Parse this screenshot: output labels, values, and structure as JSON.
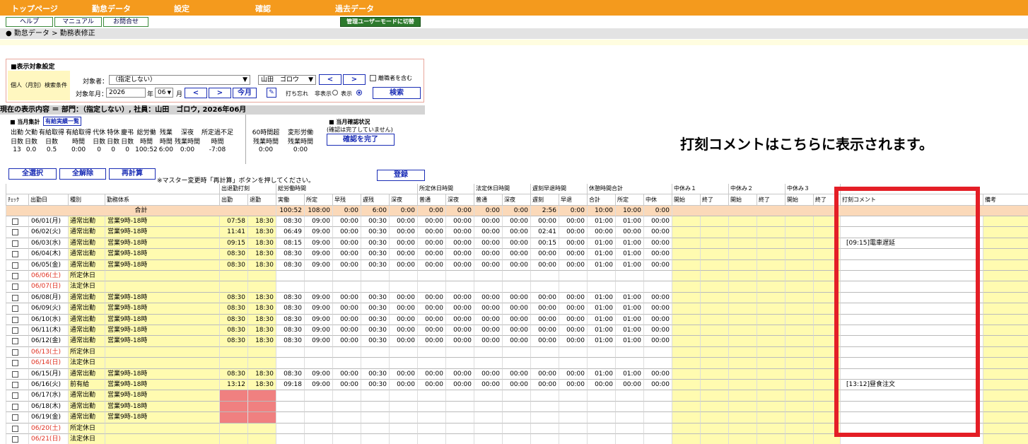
{
  "nav": {
    "items": [
      "トップページ",
      "勤怠データ",
      "設定",
      "確認",
      "過去データ"
    ]
  },
  "subnav": {
    "items": [
      "ヘルプ",
      "マニュアル",
      "お問合せ"
    ],
    "admin": "管理ユーザーモードに切替"
  },
  "breadcrumb": "● 勤怠データ > 勤務表修正",
  "filter": {
    "title": "■表示対象設定",
    "cond_label": "個人（月別）検索条件",
    "target_label": "対象者：",
    "target_value": "（指定しない）",
    "employee": "山田　ゴロウ",
    "prev": "<",
    "next": ">",
    "include_retired": "離職者を含む",
    "ym_label": "対象年月：",
    "year": "2026",
    "year_unit": "年",
    "month": "06",
    "month_unit": "月",
    "this_month": "今月",
    "missing_label": "打ち忘れ",
    "hide": "非表示",
    "show": "表示",
    "search": "検索"
  },
  "current": "現在の表示内容 ＝ 部門：（指定しない）, 社員：山田　ゴロウ, 2026年06月",
  "summary": {
    "title": "■ 当月集計",
    "link": "有給実績一覧",
    "h1": [
      "出勤",
      "欠勤",
      "有給取得",
      "有給取得",
      "代休",
      "特休",
      "慶弔",
      "総労働",
      "残業",
      "深夜",
      "所定過不足"
    ],
    "h2": [
      "日数",
      "日数",
      "日数",
      "時間",
      "日数",
      "日数",
      "日数",
      "時間",
      "時間",
      "残業時間",
      "時間"
    ],
    "vals": [
      "13",
      "0.0",
      "0.5",
      "0:00",
      "0",
      "0",
      "0",
      "100:52",
      "6:00",
      "0:00",
      "-7:08"
    ],
    "h60a": [
      "60時間超",
      "変形労働"
    ],
    "h60b": [
      "残業時間",
      "残業時間"
    ],
    "v60": [
      "0:00",
      "0:00"
    ]
  },
  "confirm": {
    "title": "■ 当月確認状況",
    "note": "(確認は完了していません)",
    "button": "確認を完了"
  },
  "message": "打刻コメントはこちらに表示されます。",
  "actions": {
    "select_all": "全選択",
    "clear_all": "全解除",
    "recalc": "再計算",
    "note": "※マスター変更時「再計算」ボタンを押してください。",
    "register": "登録"
  },
  "table": {
    "groups": [
      "出退勤打刻",
      "総労働時間",
      "所定休日時間",
      "法定休日時間",
      "遅刻早退時間",
      "休憩時間合計",
      "中休み１",
      "中休み２",
      "中休み３"
    ],
    "headers": [
      "ﾁｪｯｸ",
      "出勤日",
      "種別",
      "勤務体系",
      "出勤",
      "退勤",
      "実働",
      "所定",
      "早残",
      "遅残",
      "深夜",
      "普通",
      "深夜",
      "普通",
      "深夜",
      "遅刻",
      "早退",
      "合計",
      "所定",
      "中休",
      "開始",
      "終了",
      "開始",
      "終了",
      "開始",
      "終了",
      "打刻コメント",
      "備考"
    ],
    "total_label": "合計",
    "totals": [
      "100:52",
      "108:00",
      "0:00",
      "6:00",
      "0:00",
      "0:00",
      "0:00",
      "0:00",
      "0:00",
      "2:56",
      "0:00",
      "10:00",
      "10:00",
      "0:00"
    ],
    "rows": [
      {
        "date": "06/01(月)",
        "type": "通常出勤",
        "shift": "営業9時-18時",
        "in": "07:58",
        "out": "18:30",
        "t": [
          "08:30",
          "09:00",
          "00:00",
          "00:30",
          "00:00",
          "00:00",
          "00:00",
          "00:00",
          "00:00",
          "00:00",
          "00:00",
          "01:00",
          "01:00",
          "00:00"
        ],
        "comment": "",
        "kind": "work"
      },
      {
        "date": "06/02(火)",
        "type": "通常出勤",
        "shift": "営業9時-18時",
        "in": "11:41",
        "out": "18:30",
        "t": [
          "06:49",
          "09:00",
          "00:00",
          "00:30",
          "00:00",
          "00:00",
          "00:00",
          "00:00",
          "00:00",
          "02:41",
          "00:00",
          "00:00",
          "00:00",
          "00:00"
        ],
        "comment": "",
        "kind": "work"
      },
      {
        "date": "06/03(水)",
        "type": "通常出勤",
        "shift": "営業9時-18時",
        "in": "09:15",
        "out": "18:30",
        "t": [
          "08:15",
          "09:00",
          "00:00",
          "00:30",
          "00:00",
          "00:00",
          "00:00",
          "00:00",
          "00:00",
          "00:15",
          "00:00",
          "01:00",
          "01:00",
          "00:00"
        ],
        "comment": "[09:15]電車遅延",
        "kind": "work"
      },
      {
        "date": "06/04(木)",
        "type": "通常出勤",
        "shift": "営業9時-18時",
        "in": "08:30",
        "out": "18:30",
        "t": [
          "08:30",
          "09:00",
          "00:00",
          "00:30",
          "00:00",
          "00:00",
          "00:00",
          "00:00",
          "00:00",
          "00:00",
          "00:00",
          "01:00",
          "01:00",
          "00:00"
        ],
        "comment": "",
        "kind": "work"
      },
      {
        "date": "06/05(金)",
        "type": "通常出勤",
        "shift": "営業9時-18時",
        "in": "08:30",
        "out": "18:30",
        "t": [
          "08:30",
          "09:00",
          "00:00",
          "00:30",
          "00:00",
          "00:00",
          "00:00",
          "00:00",
          "00:00",
          "00:00",
          "00:00",
          "01:00",
          "01:00",
          "00:00"
        ],
        "comment": "",
        "kind": "work"
      },
      {
        "date": "06/06(土)",
        "type": "所定休日",
        "shift": "",
        "in": "",
        "out": "",
        "t": [],
        "comment": "",
        "kind": "hol"
      },
      {
        "date": "06/07(日)",
        "type": "法定休日",
        "shift": "",
        "in": "",
        "out": "",
        "t": [],
        "comment": "",
        "kind": "hol"
      },
      {
        "date": "06/08(月)",
        "type": "通常出勤",
        "shift": "営業9時-18時",
        "in": "08:30",
        "out": "18:30",
        "t": [
          "08:30",
          "09:00",
          "00:00",
          "00:30",
          "00:00",
          "00:00",
          "00:00",
          "00:00",
          "00:00",
          "00:00",
          "00:00",
          "01:00",
          "01:00",
          "00:00"
        ],
        "comment": "",
        "kind": "work"
      },
      {
        "date": "06/09(火)",
        "type": "通常出勤",
        "shift": "営業9時-18時",
        "in": "08:30",
        "out": "18:30",
        "t": [
          "08:30",
          "09:00",
          "00:00",
          "00:30",
          "00:00",
          "00:00",
          "00:00",
          "00:00",
          "00:00",
          "00:00",
          "00:00",
          "01:00",
          "01:00",
          "00:00"
        ],
        "comment": "",
        "kind": "work"
      },
      {
        "date": "06/10(水)",
        "type": "通常出勤",
        "shift": "営業9時-18時",
        "in": "08:30",
        "out": "18:30",
        "t": [
          "08:30",
          "09:00",
          "00:00",
          "00:30",
          "00:00",
          "00:00",
          "00:00",
          "00:00",
          "00:00",
          "00:00",
          "00:00",
          "01:00",
          "01:00",
          "00:00"
        ],
        "comment": "",
        "kind": "work"
      },
      {
        "date": "06/11(木)",
        "type": "通常出勤",
        "shift": "営業9時-18時",
        "in": "08:30",
        "out": "18:30",
        "t": [
          "08:30",
          "09:00",
          "00:00",
          "00:30",
          "00:00",
          "00:00",
          "00:00",
          "00:00",
          "00:00",
          "00:00",
          "00:00",
          "01:00",
          "01:00",
          "00:00"
        ],
        "comment": "",
        "kind": "work"
      },
      {
        "date": "06/12(金)",
        "type": "通常出勤",
        "shift": "営業9時-18時",
        "in": "08:30",
        "out": "18:30",
        "t": [
          "08:30",
          "09:00",
          "00:00",
          "00:30",
          "00:00",
          "00:00",
          "00:00",
          "00:00",
          "00:00",
          "00:00",
          "00:00",
          "01:00",
          "01:00",
          "00:00"
        ],
        "comment": "",
        "kind": "work"
      },
      {
        "date": "06/13(土)",
        "type": "所定休日",
        "shift": "",
        "in": "",
        "out": "",
        "t": [],
        "comment": "",
        "kind": "hol"
      },
      {
        "date": "06/14(日)",
        "type": "法定休日",
        "shift": "",
        "in": "",
        "out": "",
        "t": [],
        "comment": "",
        "kind": "hol"
      },
      {
        "date": "06/15(月)",
        "type": "通常出勤",
        "shift": "営業9時-18時",
        "in": "08:30",
        "out": "18:30",
        "t": [
          "08:30",
          "09:00",
          "00:00",
          "00:30",
          "00:00",
          "00:00",
          "00:00",
          "00:00",
          "00:00",
          "00:00",
          "00:00",
          "01:00",
          "01:00",
          "00:00"
        ],
        "comment": "",
        "kind": "work"
      },
      {
        "date": "06/16(火)",
        "type": "前有給",
        "shift": "営業9時-18時",
        "in": "13:12",
        "out": "18:30",
        "t": [
          "09:18",
          "09:00",
          "00:00",
          "00:30",
          "00:00",
          "00:00",
          "00:00",
          "00:00",
          "00:00",
          "00:00",
          "00:00",
          "00:00",
          "00:00",
          "00:00"
        ],
        "comment": "[13:12]昼食注文",
        "kind": "work"
      },
      {
        "date": "06/17(水)",
        "type": "通常出勤",
        "shift": "営業9時-18時",
        "in": "",
        "out": "",
        "t": [],
        "comment": "",
        "kind": "miss"
      },
      {
        "date": "06/18(木)",
        "type": "通常出勤",
        "shift": "営業9時-18時",
        "in": "",
        "out": "",
        "t": [],
        "comment": "",
        "kind": "miss"
      },
      {
        "date": "06/19(金)",
        "type": "通常出勤",
        "shift": "営業9時-18時",
        "in": "",
        "out": "",
        "t": [],
        "comment": "",
        "kind": "miss"
      },
      {
        "date": "06/20(土)",
        "type": "所定休日",
        "shift": "",
        "in": "",
        "out": "",
        "t": [],
        "comment": "",
        "kind": "hol"
      },
      {
        "date": "06/21(日)",
        "type": "法定休日",
        "shift": "",
        "in": "",
        "out": "",
        "t": [],
        "comment": "",
        "kind": "hol"
      }
    ]
  },
  "colors": {
    "nav": "#f49a1d",
    "holiday_text": "#e03020",
    "missing_punch": "#f08080",
    "yellow": "#fffbb0",
    "highlight": "#e41e26",
    "total_row": "#fbd9b9"
  }
}
